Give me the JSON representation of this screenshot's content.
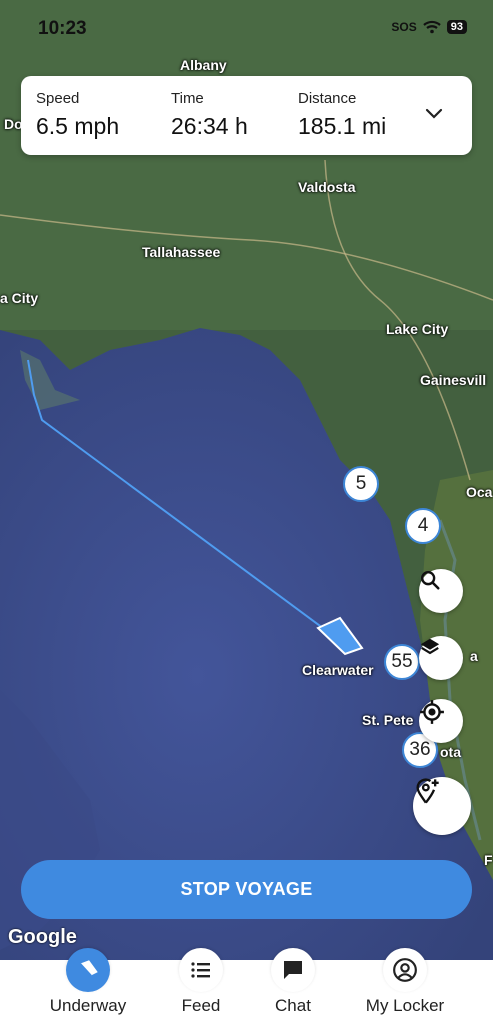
{
  "status_bar": {
    "time": "10:23",
    "sos": "SOS",
    "battery": "93"
  },
  "stats": {
    "speed": {
      "label": "Speed",
      "value": "6.5 mph"
    },
    "time": {
      "label": "Time",
      "value": "26:34 h"
    },
    "distance": {
      "label": "Distance",
      "value": "185.1 mi"
    }
  },
  "map": {
    "places": [
      "Albany",
      "Do",
      "Valdosta",
      "Tallahassee",
      "a City",
      "Lake City",
      "Gainesvill",
      "Oca",
      "Clearwater",
      "St. Pete",
      "a",
      "ota",
      "F"
    ],
    "markers": [
      "5",
      "4",
      "55",
      "36"
    ],
    "attribution": "Google"
  },
  "actions": {
    "stop_voyage": "STOP VOYAGE"
  },
  "tabs": [
    {
      "label": "Underway",
      "icon": "boat-icon",
      "active": true
    },
    {
      "label": "Feed",
      "icon": "list-icon",
      "active": false
    },
    {
      "label": "Chat",
      "icon": "chat-icon",
      "active": false
    },
    {
      "label": "My Locker",
      "icon": "user-icon",
      "active": false
    }
  ],
  "colors": {
    "accent": "#3f8ae0",
    "water": "#3d4f8f",
    "land": "#3f5a3a"
  }
}
